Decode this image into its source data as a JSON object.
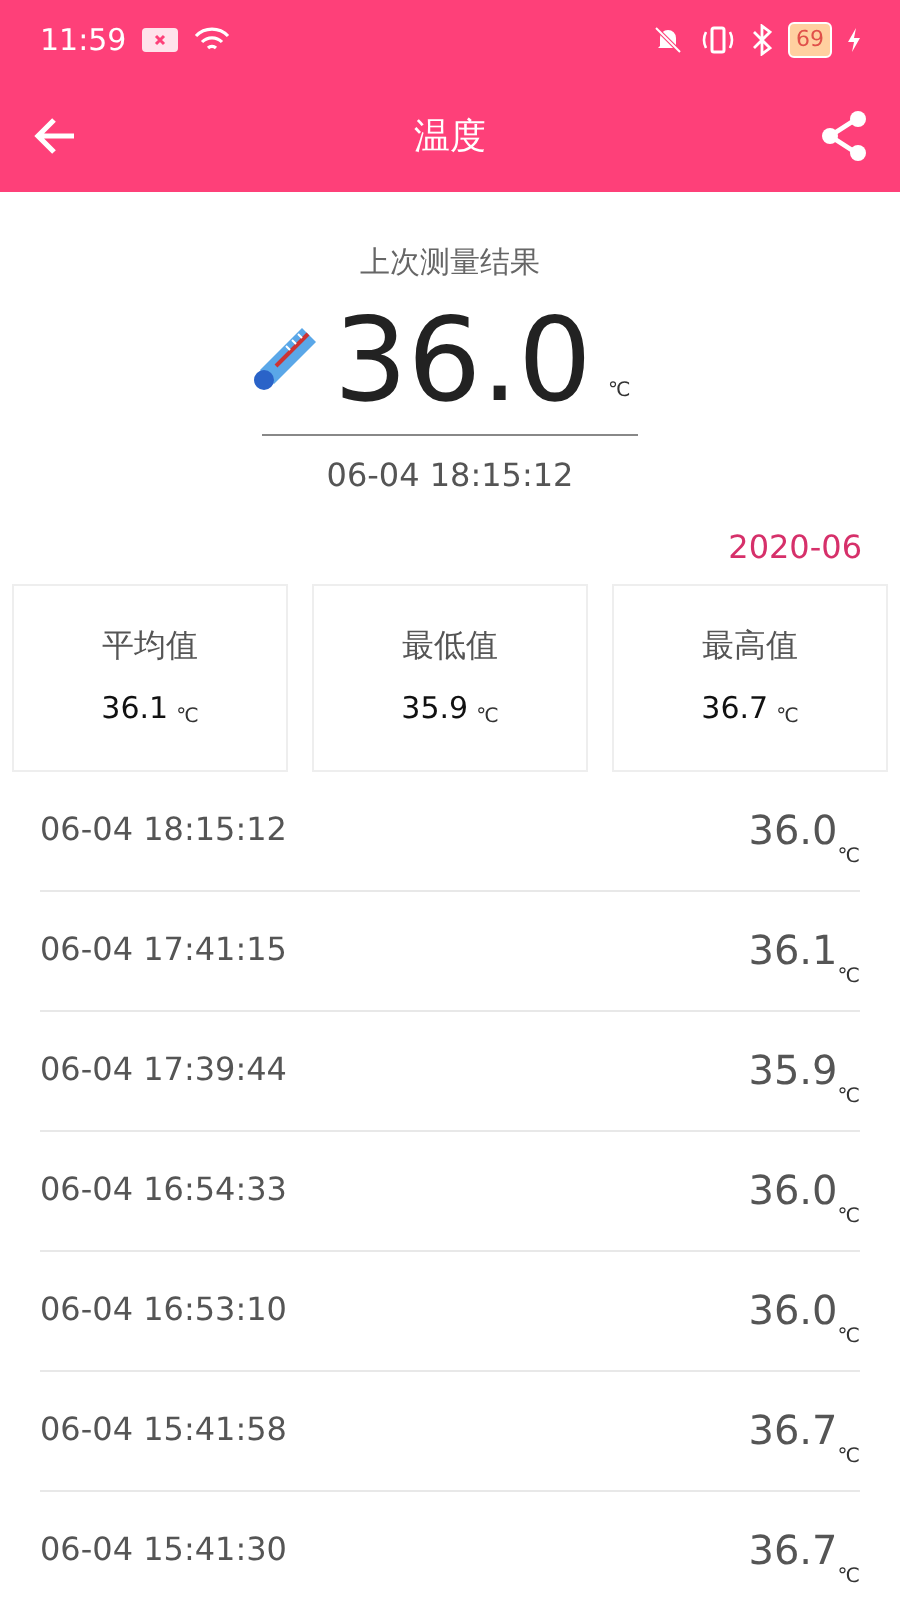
{
  "status_bar": {
    "time": "11:59",
    "battery": "69"
  },
  "toolbar": {
    "title": "温度"
  },
  "latest": {
    "caption": "上次测量结果",
    "value": "36.0",
    "unit": "℃",
    "time": "06-04 18:15:12"
  },
  "month": "2020-06",
  "stats": [
    {
      "label": "平均值",
      "value": "36.1",
      "unit": "℃"
    },
    {
      "label": "最低值",
      "value": "35.9",
      "unit": "℃"
    },
    {
      "label": "最高值",
      "value": "36.7",
      "unit": "℃"
    }
  ],
  "records": [
    {
      "time": "06-04 18:15:12",
      "value": "36.0",
      "unit": "℃"
    },
    {
      "time": "06-04 17:41:15",
      "value": "36.1",
      "unit": "℃"
    },
    {
      "time": "06-04 17:39:44",
      "value": "35.9",
      "unit": "℃"
    },
    {
      "time": "06-04 16:54:33",
      "value": "36.0",
      "unit": "℃"
    },
    {
      "time": "06-04 16:53:10",
      "value": "36.0",
      "unit": "℃"
    },
    {
      "time": "06-04 15:41:58",
      "value": "36.7",
      "unit": "℃"
    },
    {
      "time": "06-04 15:41:30",
      "value": "36.7",
      "unit": "℃"
    }
  ]
}
